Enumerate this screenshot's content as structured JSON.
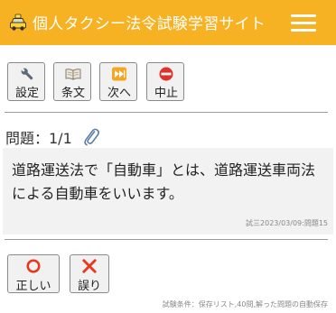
{
  "header": {
    "title": "個人タクシー法令試験学習サイト",
    "logo_icon": "taxi-icon",
    "menu_icon": "hamburger-menu-icon",
    "bg_color": "#f7b223"
  },
  "toolbar": {
    "buttons": [
      {
        "label": "設定",
        "icon": "wrench-icon"
      },
      {
        "label": "条文",
        "icon": "book-icon"
      },
      {
        "label": "次へ",
        "icon": "next-track-icon"
      },
      {
        "label": "中止",
        "icon": "no-entry-icon"
      }
    ]
  },
  "question": {
    "number_label": "問題：1/1",
    "attach_icon": "paperclip-icon",
    "text": "道路運送法で「自動車」とは、道路運送車両法による自動車をいいます。",
    "meta": "試三2023/03/09:問題15"
  },
  "answers": {
    "correct": {
      "label": "正しい",
      "icon": "circle-icon",
      "color": "#e8381b"
    },
    "wrong": {
      "label": "誤り",
      "icon": "cross-icon",
      "color": "#e8381b"
    }
  },
  "footer": {
    "note": "試験条件：保存リスト,40問,解った問題の自動保存"
  }
}
